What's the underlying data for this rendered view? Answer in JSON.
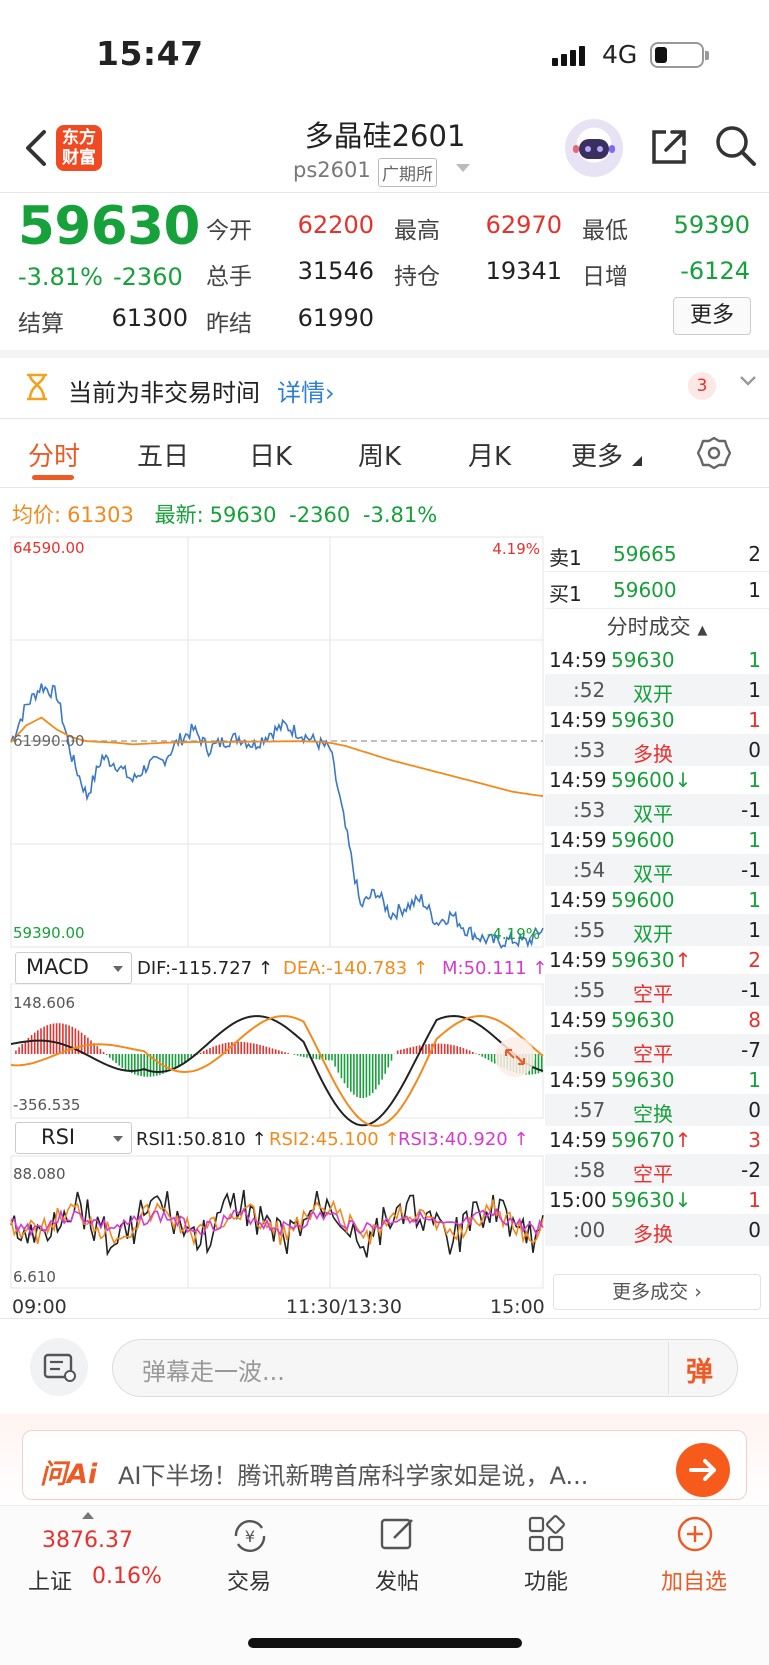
{
  "status_bar": {
    "time": "15:47",
    "network": "4G"
  },
  "header": {
    "logo_text": "东方财富",
    "title": "多晶硅2601",
    "code": "ps2601",
    "exchange": "广期所"
  },
  "quote": {
    "price": "59630",
    "change_pct": "-3.81%",
    "change": "-2360",
    "fields": [
      {
        "label": "今开",
        "value": "62200",
        "color": "red"
      },
      {
        "label": "最高",
        "value": "62970",
        "color": "red"
      },
      {
        "label": "最低",
        "value": "59390",
        "color": "green"
      },
      {
        "label": "总手",
        "value": "31546",
        "color": "black"
      },
      {
        "label": "持仓",
        "value": "19341",
        "color": "black"
      },
      {
        "label": "日增",
        "value": "-6124",
        "color": "green"
      },
      {
        "label": "结算",
        "value": "61300",
        "color": "black"
      },
      {
        "label": "昨结",
        "value": "61990",
        "color": "black"
      }
    ],
    "more_label": "更多"
  },
  "notice": {
    "text": "当前为非交易时间",
    "link": "详情",
    "count": "3"
  },
  "tabs": [
    "分时",
    "五日",
    "日K",
    "周K",
    "月K",
    "更多"
  ],
  "legend": {
    "avg_label": "均价:",
    "avg_value": "61303",
    "latest_label": "最新:",
    "latest_value": "59630",
    "latest_change": "-2360",
    "latest_pct": "-3.81%"
  },
  "chart_labels": {
    "top_price": "64590.00",
    "top_pct": "4.19%",
    "mid_price": "61990.00",
    "bottom_price": "59390.00",
    "bottom_pct": "-4.19%",
    "macd_select": "MACD",
    "dif": "DIF:-115.727 ↑",
    "dea": "DEA:-140.783 ↑",
    "m": "M:50.111 ↑",
    "macd_top": "148.606",
    "macd_bottom": "-356.535",
    "rsi_select": "RSI",
    "rsi1": "RSI1:50.810 ↑",
    "rsi2": "RSI2:45.100 ↑",
    "rsi3": "RSI3:40.920 ↑",
    "rsi_top": "88.080",
    "rsi_bottom": "6.610",
    "time_start": "09:00",
    "time_mid": "11:30/13:30",
    "time_end": "15:00"
  },
  "chart_data": {
    "type": "line",
    "x_ticks": [
      "09:00",
      "11:30/13:30",
      "15:00"
    ],
    "ylim": [
      59390,
      64590
    ],
    "prev_settle": 61990,
    "series": [
      {
        "name": "最新",
        "values": [
          61990,
          62450,
          62700,
          62600,
          61800,
          61300,
          61800,
          61700,
          61500,
          61700,
          61750,
          62000,
          62150,
          61900,
          62000,
          62050,
          61950,
          62100,
          62200,
          62100,
          62000,
          61900,
          60900,
          59900,
          60100,
          59800,
          59900,
          60000,
          59700,
          59800,
          59600,
          59500,
          59450,
          59480,
          59450,
          59630
        ]
      },
      {
        "name": "均价",
        "values": [
          61990,
          62200,
          62300,
          62150,
          62050,
          62000,
          61990,
          61980,
          61960,
          61970,
          61980,
          61985,
          61990,
          61990,
          61990,
          61992,
          61995,
          61995,
          61998,
          62000,
          61995,
          61980,
          61940,
          61880,
          61820,
          61760,
          61710,
          61660,
          61610,
          61560,
          61510,
          61460,
          61410,
          61360,
          61330,
          61303
        ]
      }
    ]
  },
  "order_book": {
    "asks": [
      {
        "label": "卖1",
        "price": "59665",
        "vol": "2"
      }
    ],
    "bids": [
      {
        "label": "买1",
        "price": "59600",
        "vol": "1"
      }
    ],
    "trades_header": "分时成交",
    "trades": [
      {
        "time": "14:59",
        "price": "59630",
        "type": "",
        "vol": "1",
        "color": "green",
        "arrow": "",
        "vol_color": "green"
      },
      {
        "time": ":52",
        "price": "",
        "type": "双开",
        "vol": "1",
        "color": "green",
        "arrow": "",
        "vol_color": "black"
      },
      {
        "time": "14:59",
        "price": "59630",
        "type": "",
        "vol": "1",
        "color": "green",
        "arrow": "",
        "vol_color": "red"
      },
      {
        "time": ":53",
        "price": "",
        "type": "多换",
        "vol": "0",
        "color": "red",
        "arrow": "",
        "vol_color": "black"
      },
      {
        "time": "14:59",
        "price": "59600",
        "type": "",
        "vol": "1",
        "color": "green",
        "arrow": "↓",
        "vol_color": "green"
      },
      {
        "time": ":53",
        "price": "",
        "type": "双平",
        "vol": "-1",
        "color": "green",
        "arrow": "",
        "vol_color": "black"
      },
      {
        "time": "14:59",
        "price": "59600",
        "type": "",
        "vol": "1",
        "color": "green",
        "arrow": "",
        "vol_color": "green"
      },
      {
        "time": ":54",
        "price": "",
        "type": "双平",
        "vol": "-1",
        "color": "green",
        "arrow": "",
        "vol_color": "black"
      },
      {
        "time": "14:59",
        "price": "59600",
        "type": "",
        "vol": "1",
        "color": "green",
        "arrow": "",
        "vol_color": "green"
      },
      {
        "time": ":55",
        "price": "",
        "type": "双开",
        "vol": "1",
        "color": "green",
        "arrow": "",
        "vol_color": "black"
      },
      {
        "time": "14:59",
        "price": "59630",
        "type": "",
        "vol": "2",
        "color": "green",
        "arrow": "↑",
        "vol_color": "red"
      },
      {
        "time": ":55",
        "price": "",
        "type": "空平",
        "vol": "-1",
        "color": "red",
        "arrow": "",
        "vol_color": "black"
      },
      {
        "time": "14:59",
        "price": "59630",
        "type": "",
        "vol": "8",
        "color": "green",
        "arrow": "",
        "vol_color": "red"
      },
      {
        "time": ":56",
        "price": "",
        "type": "空平",
        "vol": "-7",
        "color": "red",
        "arrow": "",
        "vol_color": "black"
      },
      {
        "time": "14:59",
        "price": "59630",
        "type": "",
        "vol": "1",
        "color": "green",
        "arrow": "",
        "vol_color": "green"
      },
      {
        "time": ":57",
        "price": "",
        "type": "空换",
        "vol": "0",
        "color": "green",
        "arrow": "",
        "vol_color": "black"
      },
      {
        "time": "14:59",
        "price": "59670",
        "type": "",
        "vol": "3",
        "color": "green",
        "arrow": "↑",
        "vol_color": "red"
      },
      {
        "time": ":58",
        "price": "",
        "type": "空平",
        "vol": "-2",
        "color": "red",
        "arrow": "",
        "vol_color": "black"
      },
      {
        "time": "15:00",
        "price": "59630",
        "type": "",
        "vol": "1",
        "color": "green",
        "arrow": "↓",
        "vol_color": "red"
      },
      {
        "time": ":00",
        "price": "",
        "type": "多换",
        "vol": "0",
        "color": "red",
        "arrow": "",
        "vol_color": "black"
      }
    ],
    "more_trades": "更多成交"
  },
  "danmaku": {
    "placeholder": "弹幕走一波...",
    "button": "弹"
  },
  "ai_banner": {
    "logo": "问Ai",
    "text": "AI下半场！腾讯新聘首席科学家如是说，A..."
  },
  "bottom_nav": {
    "index_value": "3876.37",
    "index_name": "上证",
    "index_pct": "0.16%",
    "items": [
      "交易",
      "发帖",
      "功能",
      "加自选"
    ]
  },
  "colors": {
    "red": "#e8302c",
    "green": "#16a13a",
    "orange": "#f28a1d",
    "brand": "#ee5a24",
    "blue_line": "#3a78c8"
  }
}
